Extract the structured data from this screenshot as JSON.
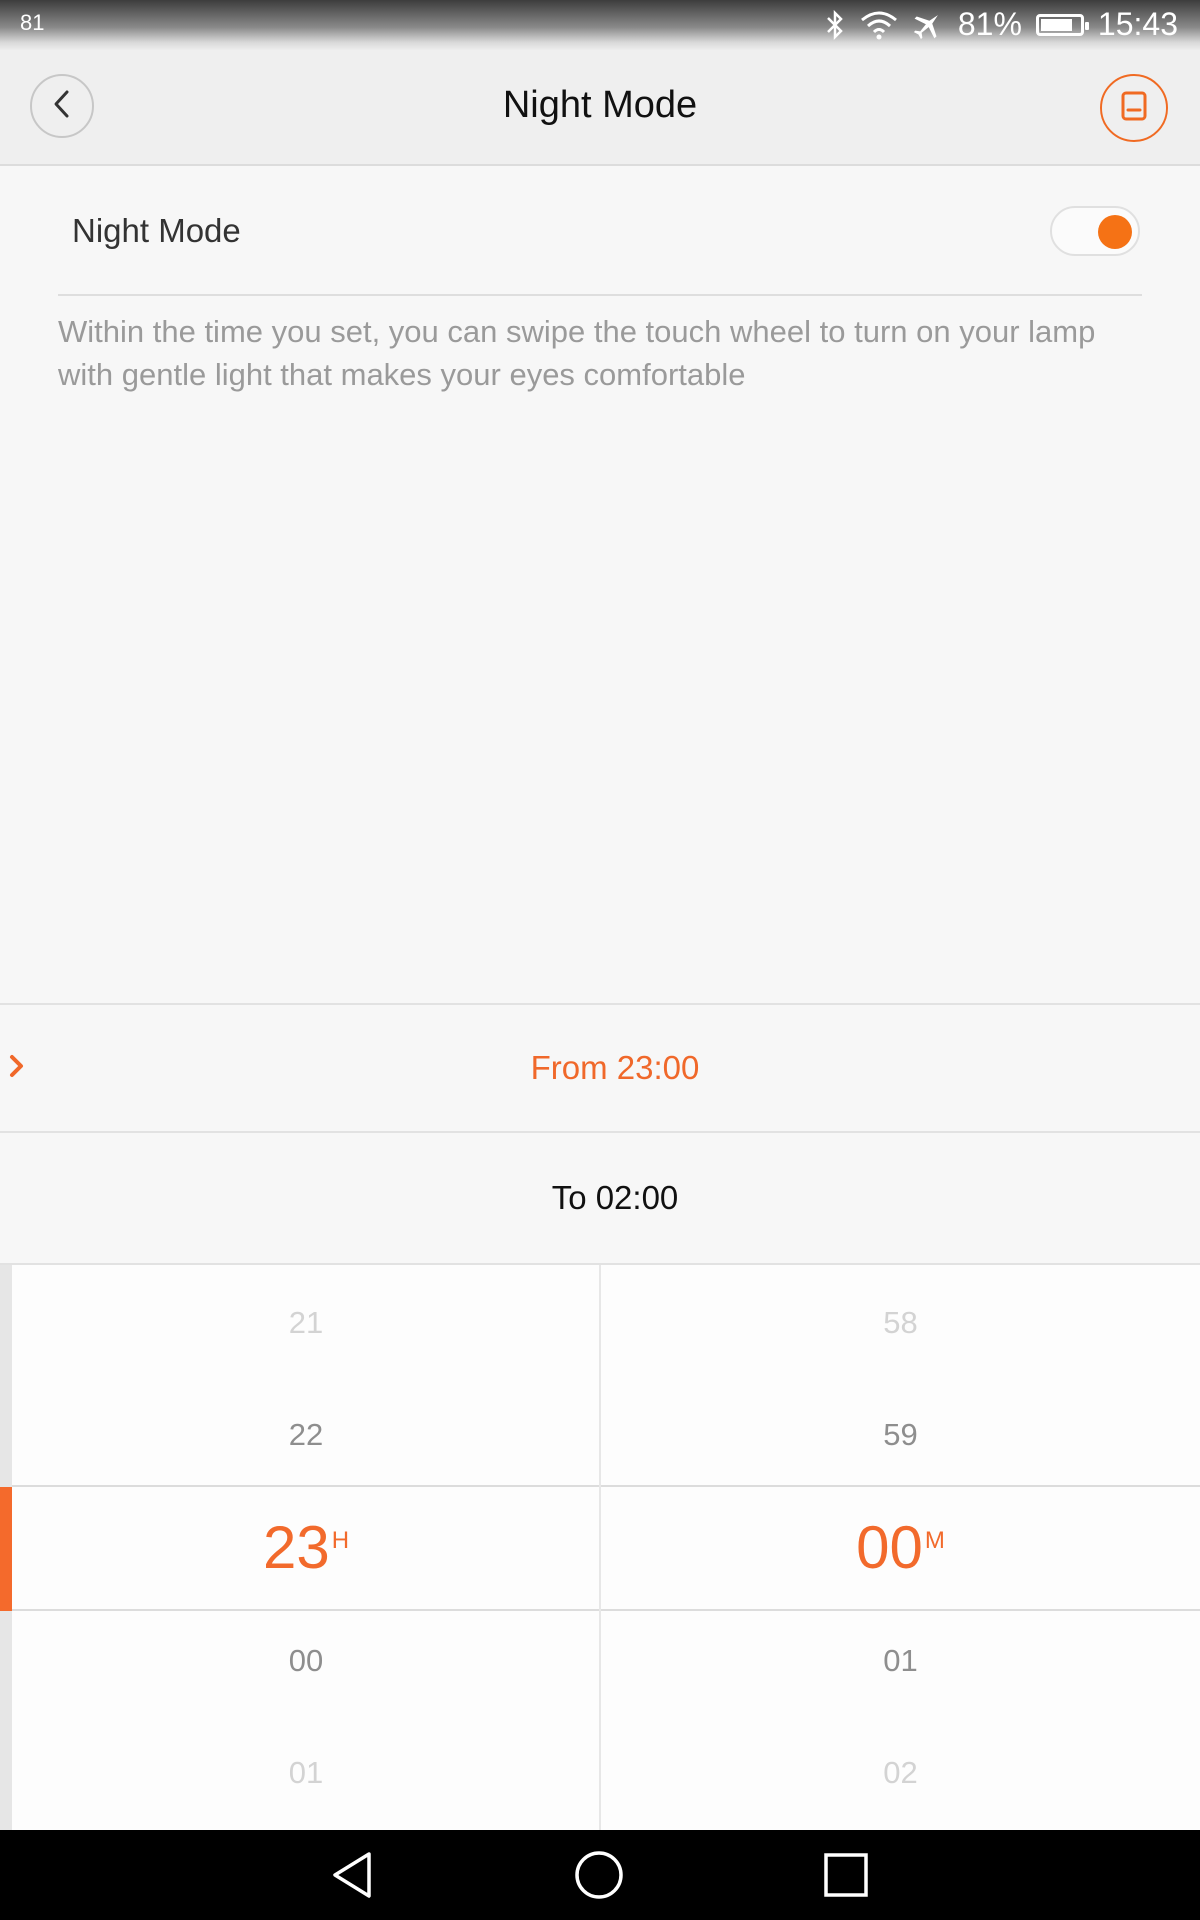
{
  "status_bar": {
    "left_text": "81",
    "battery_percent": "81%",
    "battery_level": 0.81,
    "time": "15:43",
    "icons": [
      "bluetooth-icon",
      "wifi-icon",
      "airplane-mode-icon",
      "battery-icon"
    ]
  },
  "header": {
    "title": "Night Mode",
    "back_icon": "chevron-left-icon",
    "save_icon": "save-icon",
    "accent_color": "#f06a22"
  },
  "setting": {
    "label": "Night Mode",
    "toggle_on": true,
    "description": "Within the time you set, you can swipe the touch wheel to turn on your lamp with gentle light that makes your eyes comfortable"
  },
  "schedule": {
    "from_label": "From 23:00",
    "to_label": "To 02:00",
    "active_row": "from"
  },
  "picker": {
    "hours": {
      "above": [
        "21",
        "22"
      ],
      "selected": "23",
      "unit": "H",
      "below": [
        "00",
        "01"
      ]
    },
    "minutes": {
      "above": [
        "58",
        "59"
      ],
      "selected": "00",
      "unit": "M",
      "below": [
        "01",
        "02"
      ]
    }
  },
  "navigation_bar": {
    "buttons": [
      "back-triangle-icon",
      "home-circle-icon",
      "recents-square-icon"
    ]
  }
}
